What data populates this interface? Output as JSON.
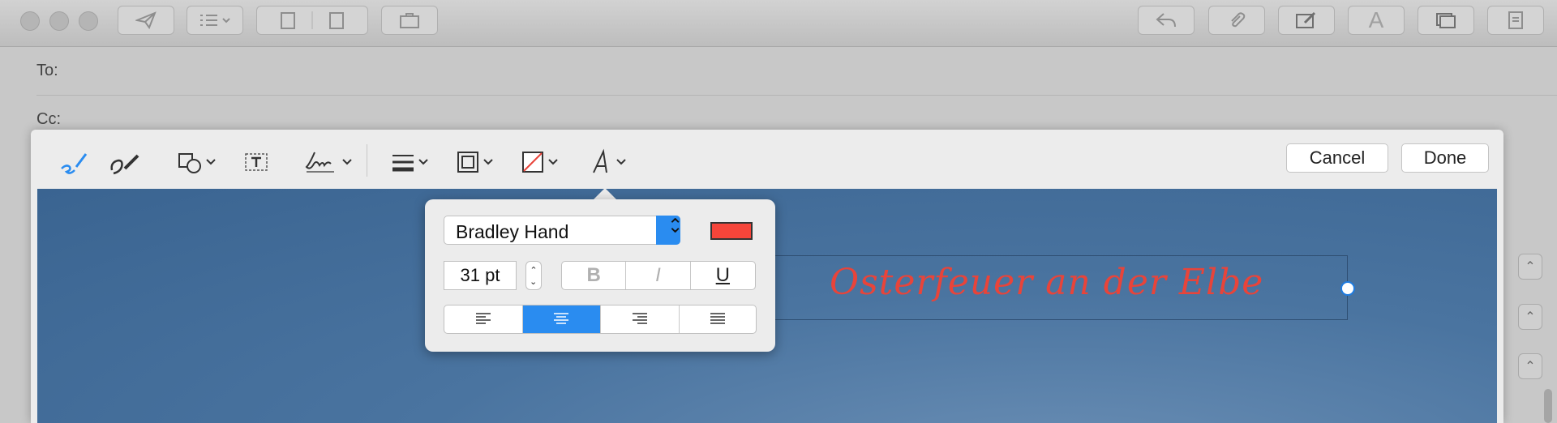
{
  "mail": {
    "to_label": "To:",
    "cc_label": "Cc:",
    "toolbar": {
      "send_icon": "paper-plane-icon",
      "list_icon": "list-icon",
      "format_label": "A"
    }
  },
  "markup": {
    "tools": [
      "sketch-icon",
      "draw-icon",
      "shapes-icon",
      "text-icon",
      "sign-icon",
      "shape-style-icon",
      "border-color-icon",
      "fill-color-icon",
      "text-style-icon"
    ],
    "cancel_label": "Cancel",
    "done_label": "Done",
    "annotation_text": "Osterfeuer an der Elbe",
    "annotation_color": "#e8443a"
  },
  "text_style_popover": {
    "font_name": "Bradley Hand",
    "color_swatch": "#f5453a",
    "size_value": "31 pt",
    "bold_label": "B",
    "italic_label": "I",
    "underline_label": "U",
    "alignment_selected": "center",
    "alignments": [
      "left",
      "center",
      "right",
      "justify"
    ]
  }
}
